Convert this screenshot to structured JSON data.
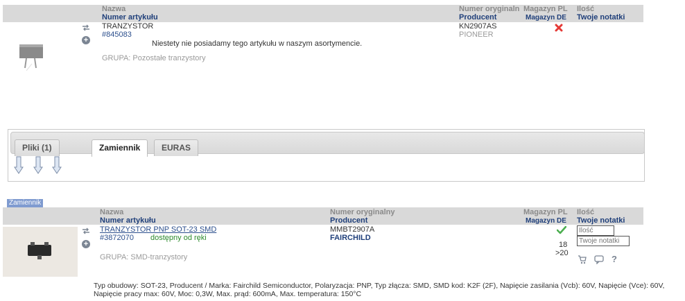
{
  "columns": {
    "name": "Nazwa",
    "article_no": "Numer artykułu",
    "original_no": "Numer oryginalny",
    "original_no_truncated": "Numer oryginaln",
    "producer": "Producent",
    "stock_pl": "Magazyn PL",
    "stock_de": "Magazyn DE",
    "quantity": "Ilość",
    "notes": "Twoje notatki"
  },
  "item1": {
    "name": "TRANZYSTOR",
    "article_no": "#845083",
    "unavailable_msg": "Niestety nie posiadamy tego artykułu w naszym asortymencie.",
    "group": "GRUPA: Pozostałe tranzystory",
    "original_no": "KN2907AS",
    "producer": "PIONEER",
    "status_icon": "red-x-icon"
  },
  "tabs": [
    {
      "label": "Pliki (1)"
    },
    {
      "label": "Zamiennik"
    },
    {
      "label": "EURAS"
    }
  ],
  "section_label": "Zamiennik",
  "item2": {
    "name": "TRANZYSTOR PNP SOT-23 SMD",
    "article_no": "#3872070",
    "availability": "dostępny od ręki",
    "group": "GRUPA: SMD-tranzystory",
    "original_no": "MMBT2907A",
    "producer": "FAIRCHILD",
    "status_icon": "green-check-icon",
    "stock_pl": "18",
    "stock_de": ">20",
    "qty_placeholder": "Ilość",
    "notes_placeholder": "Twoje notatki",
    "description_line1": "Typ obudowy: SOT-23, Producent / Marka: Fairchild Semiconductor, Polaryzacja: PNP, Typ złącza: SMD, SMD kod: K2F (2F), Napięcie zasilania (Vcb): 60V, Napięcie (Vce): 60V,",
    "description_line2": "Napięcie pracy max: 60V, Moc: 0,3W, Max. prąd: 600mA, Max. temperatura: 150°C"
  },
  "colors": {
    "header_bg": "#d9d9d9",
    "header_blue": "#1f3f7a",
    "link_blue": "#2b4e8c",
    "green": "#2c8a2c",
    "red": "#e53935"
  }
}
